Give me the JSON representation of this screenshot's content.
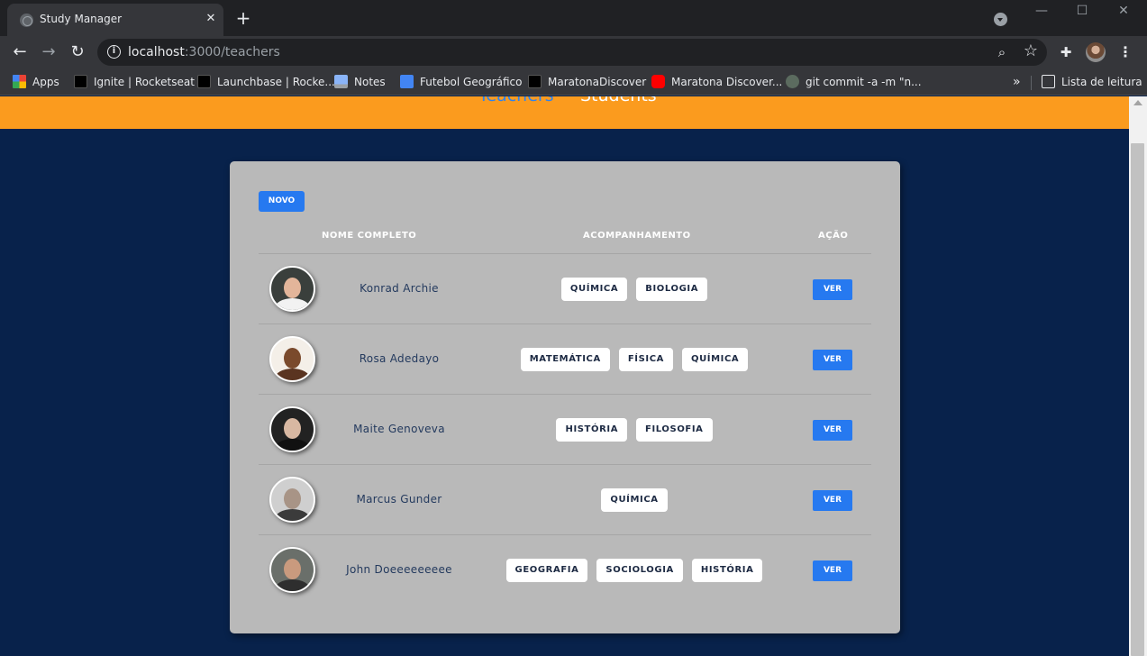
{
  "browser": {
    "tab_title": "Study Manager",
    "tab_close": "✕",
    "new_tab": "+",
    "window_min": "—",
    "window_max": "☐",
    "window_close": "✕",
    "url_host": "localhost",
    "url_rest": ":3000/teachers",
    "bookmarks": [
      {
        "label": "Apps",
        "icon": "apps-icon"
      },
      {
        "label": "Ignite | Rocketseat",
        "icon": "rocketseat-icon"
      },
      {
        "label": "Launchbase | Rocke...",
        "icon": "rocketseat-icon"
      },
      {
        "label": "Notes",
        "icon": "laptop-icon"
      },
      {
        "label": "Futebol Geográfico",
        "icon": "docs-icon"
      },
      {
        "label": "MaratonaDiscover",
        "icon": "page-icon"
      },
      {
        "label": "Maratona Discover...",
        "icon": "youtube-icon"
      },
      {
        "label": "git commit -a -m \"n...",
        "icon": "git-icon"
      }
    ],
    "bookmarks_more": "»",
    "reading_list": "Lista de leitura"
  },
  "nav": {
    "teachers": "Teachers",
    "students": "Students"
  },
  "toolbar": {
    "new_label": "NOVO"
  },
  "table": {
    "headers": {
      "name": "NOME COMPLETO",
      "subjects": "ACOMPANHAMENTO",
      "action": "AÇÃO"
    },
    "rows": [
      {
        "name": "Konrad Archie",
        "subjects": [
          "QUÍMICA",
          "BIOLOGIA"
        ],
        "action": "VER"
      },
      {
        "name": "Rosa Adedayo",
        "subjects": [
          "MATEMÁTICA",
          "FÍSICA",
          "QUÍMICA"
        ],
        "action": "VER"
      },
      {
        "name": "Maite Genoveva",
        "subjects": [
          "HISTÓRIA",
          "FILOSOFIA"
        ],
        "action": "VER"
      },
      {
        "name": "Marcus Gunder",
        "subjects": [
          "QUÍMICA"
        ],
        "action": "VER"
      },
      {
        "name": "John Doeeeeeeeee",
        "subjects": [
          "GEOGRAFIA",
          "SOCIOLOGIA",
          "HISTÓRIA"
        ],
        "action": "VER"
      }
    ]
  },
  "colors": {
    "header_orange": "#fb9b1e",
    "page_navy": "#08224b",
    "card_gray": "#b9b9b9",
    "button_blue": "#2679f0",
    "active_nav_blue": "#2f83ee"
  }
}
